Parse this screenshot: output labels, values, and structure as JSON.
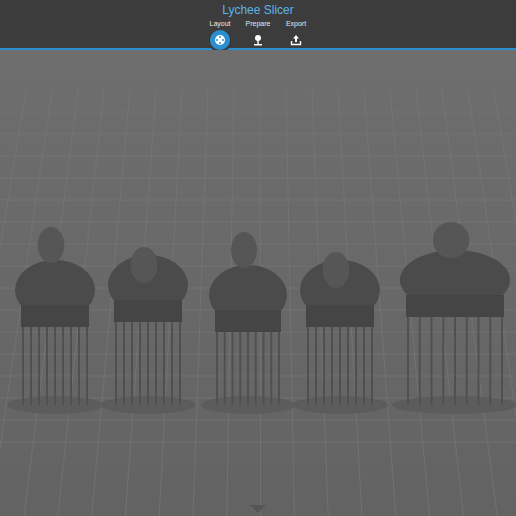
{
  "window": {
    "title": "Lychee Slicer"
  },
  "tabs": [
    {
      "label": "Layout",
      "selected": true
    },
    {
      "label": "Prepare",
      "selected": false
    },
    {
      "label": "Export",
      "selected": false
    }
  ]
}
